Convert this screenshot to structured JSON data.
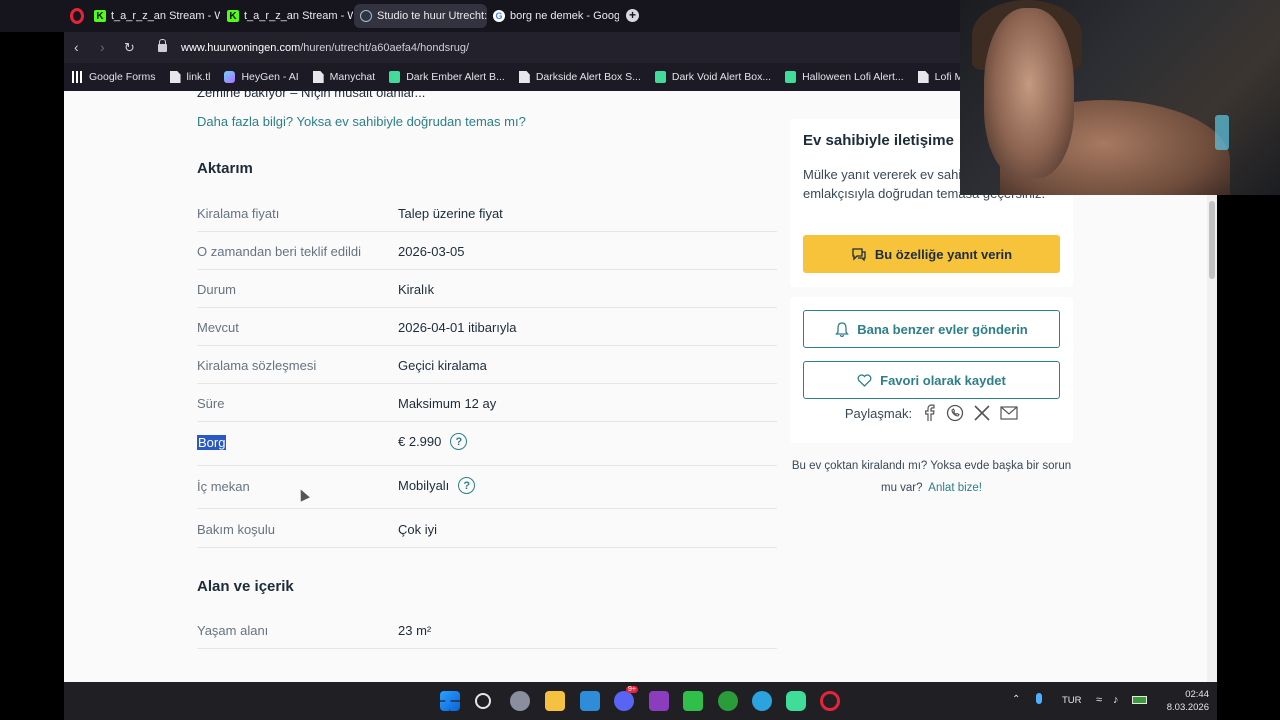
{
  "browser": {
    "tabs": [
      {
        "label": "t_a_r_z_an Stream - Watch",
        "icon": "kick-icon"
      },
      {
        "label": "t_a_r_z_an Stream - Watch",
        "icon": "kick-icon"
      },
      {
        "label": "Studio te huur Utrecht: Ho",
        "icon": "globe-icon"
      },
      {
        "label": "borg ne demek - Google'd",
        "icon": "google-icon"
      }
    ],
    "url_host": "www.huurwoningen.com",
    "url_path": "/huren/utrecht/a60aefa4/hondsrug/",
    "bookmarks": [
      "Google Forms",
      "link.tl",
      "HeyGen - AI",
      "Manychat",
      "Dark Ember Alert B...",
      "Darkside Alert Box S...",
      "Dark Void Alert Box...",
      "Halloween Lofi Alert...",
      "Lofi Midnight Widg..."
    ]
  },
  "page": {
    "top_cut_text": "Zemine bakıyor – Nıçin müsait olanlar...",
    "more_info_link": "Daha fazla bilgi? Yoksa ev sahibiyle doğrudan temas mı?",
    "section_transfer": "Aktarım",
    "details": [
      {
        "label": "Kiralama fiyatı",
        "value": "Talep üzerine fiyat"
      },
      {
        "label": "O zamandan beri teklif edildi",
        "value": "2026-03-05"
      },
      {
        "label": "Durum",
        "value": "Kiralık"
      },
      {
        "label": "Mevcut",
        "value": "2026-04-01 itibarıyla"
      },
      {
        "label": "Kiralama sözleşmesi",
        "value": "Geçici kiralama"
      },
      {
        "label": "Süre",
        "value": "Maksimum 12 ay"
      },
      {
        "label": "Borg",
        "value": "€ 2.990",
        "help": "?"
      },
      {
        "label": "İç mekan",
        "value": "Mobilyalı",
        "help": "?"
      },
      {
        "label": "Bakım koşulu",
        "value": "Çok iyi"
      }
    ],
    "section_area": "Alan ve içerik",
    "area_details": [
      {
        "label": "Yaşam alanı",
        "value": "23 m²"
      }
    ]
  },
  "contact": {
    "title": "Ev sahibiyle iletişime",
    "description": "Mülke yanıt vererek ev sahibinin emlakçısıyla doğrudan temasa geçersiniz.",
    "respond_button": "Bu özelliğe yanıt verin",
    "similar_button": "Bana benzer evler gönderin",
    "favorite_button": "Favori olarak kaydet",
    "share_label": "Paylaşmak:",
    "rented_note": "Bu ev çoktan kiralandı mı? Yoksa evde başka bir sorun mu var?",
    "rented_link": "Anlat bize!"
  },
  "taskbar": {
    "language": "TUR",
    "time": "02:44",
    "date": "8.03.2026",
    "badge": "9+"
  },
  "colors": {
    "accent_teal": "#2d7f89",
    "cta_yellow": "#f6c33a",
    "text_dark": "#1d2c3a",
    "selection": "#2b59c3"
  }
}
